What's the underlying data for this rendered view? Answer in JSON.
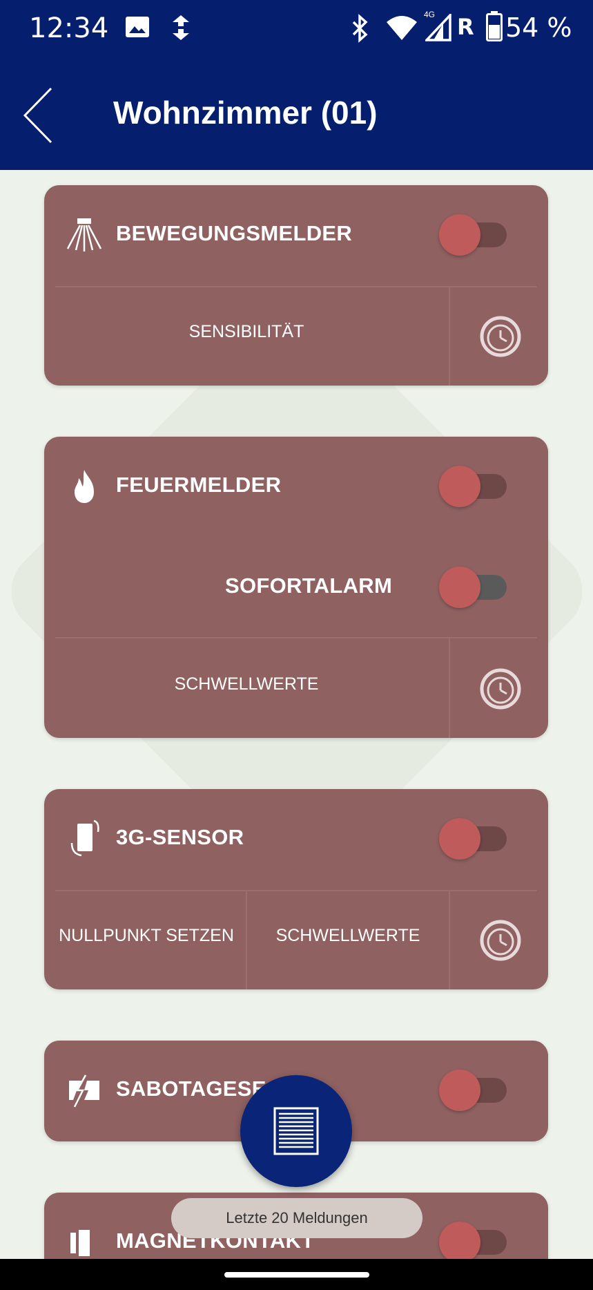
{
  "status_bar": {
    "time": "12:34",
    "network_label": "4G",
    "roaming": "R",
    "battery": "54 %",
    "icons": [
      "image-icon",
      "sync-icon",
      "bluetooth-icon",
      "wifi-icon",
      "signal-icon",
      "battery-icon"
    ]
  },
  "app_bar": {
    "title": "Wohnzimmer (01)",
    "back_icon": "chevron-left-icon"
  },
  "cards": {
    "motion": {
      "title": "BEWEGUNGSMELDER",
      "icon": "motion-sensor-icon",
      "enabled": false,
      "actions": [
        "SENSIBILITÄT"
      ]
    },
    "fire": {
      "title": "FEUERMELDER",
      "icon": "fire-icon",
      "enabled": false,
      "instant_alarm_label": "SOFORTALARM",
      "instant_alarm_enabled": false,
      "actions": [
        "SCHWELLWERTE"
      ]
    },
    "gsensor": {
      "title": "3G-SENSOR",
      "icon": "phone-rotate-icon",
      "enabled": false,
      "actions": [
        "NULLPUNKT SETZEN",
        "SCHWELLWERTE"
      ]
    },
    "tamper": {
      "title": "SABOTAGESE",
      "icon": "tamper-icon",
      "enabled": false
    },
    "magnet": {
      "title": "MAGNETKONTAKT",
      "icon": "magnet-contact-icon",
      "enabled": false
    }
  },
  "fab": {
    "icon": "list-icon"
  },
  "toast": {
    "text": "Letzte 20 Meldungen"
  },
  "colors": {
    "header": "#051f6e",
    "card": "#8f6161",
    "toggle_thumb": "#bf5b5b",
    "background": "#edf2ea",
    "fab": "#0a2577"
  }
}
